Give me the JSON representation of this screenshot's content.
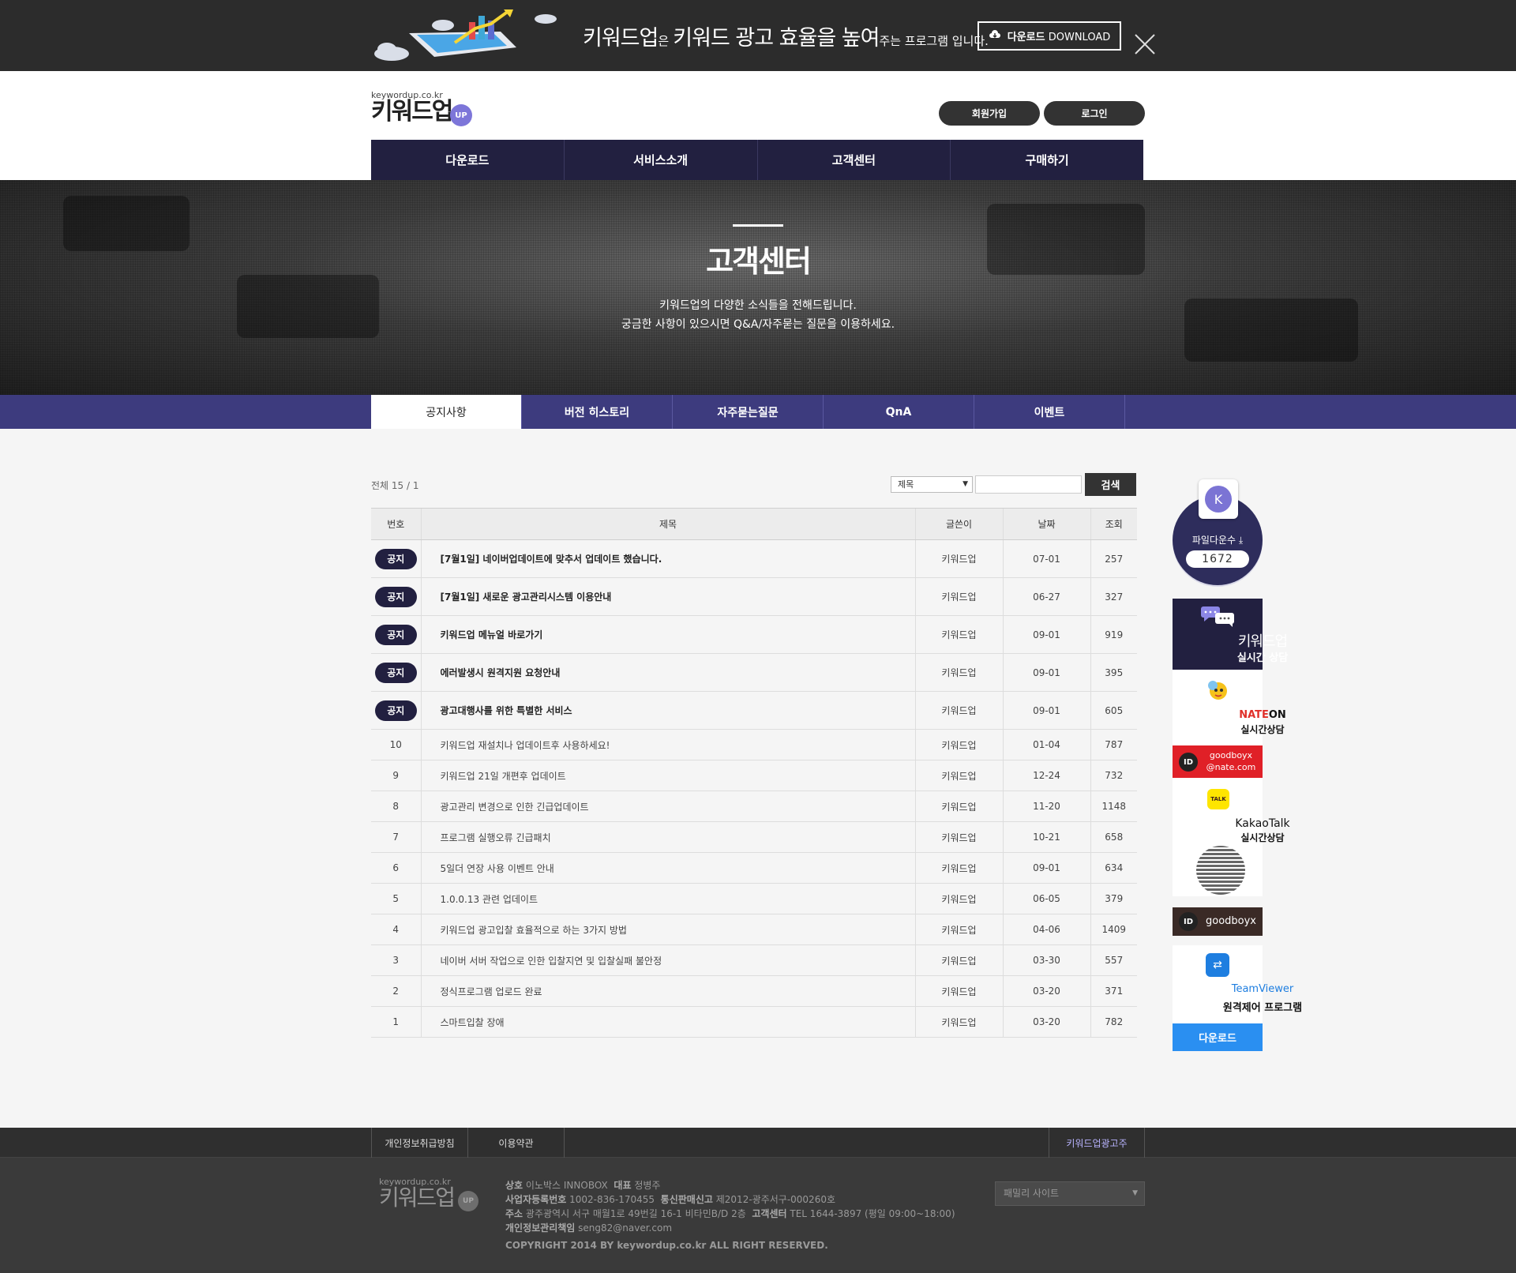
{
  "top_banner": {
    "promo_brand": "키워드업",
    "promo_particle": "은",
    "promo_main": "키워드 광고 효율을 높여",
    "promo_tail": "주는 프로그램 입니다.",
    "download_bold": "다운로드",
    "download_label": "DOWNLOAD",
    "icons": [
      "cloud-download-icon",
      "close-icon"
    ]
  },
  "header": {
    "logo_url": "keywordup.co.kr",
    "logo_name": "키워드업",
    "logo_badge": "UP",
    "join_label": "회원가입",
    "login_label": "로그인",
    "gnb": [
      "다운로드",
      "서비스소개",
      "고객센터",
      "구매하기"
    ]
  },
  "hero": {
    "title": "고객센터",
    "line1": "키워드업의 다양한 소식들을 전해드립니다.",
    "line2": "궁금한 사항이 있으시면 Q&A/자주묻는 질문을 이용하세요."
  },
  "subtabs": [
    "공지사항",
    "버전 히스토리",
    "자주묻는질문",
    "QnA",
    "이벤트"
  ],
  "board": {
    "total": "전체 15 / 1",
    "search_select": "제목",
    "search_button": "검색",
    "headers": [
      "번호",
      "제목",
      "글쓴이",
      "날짜",
      "조회"
    ],
    "notice_badge": "공지",
    "notices": [
      {
        "title": "[7월1일] 네이버업데이트에 맞추서 업데이트 했습니다.",
        "writer": "키워드업",
        "date": "07-01",
        "views": "257"
      },
      {
        "title": "[7월1일] 새로운 광고관리시스템 이용안내",
        "writer": "키워드업",
        "date": "06-27",
        "views": "327"
      },
      {
        "title": "키워드업 메뉴얼 바로가기",
        "writer": "키워드업",
        "date": "09-01",
        "views": "919"
      },
      {
        "title": "에러발생시 원격지원 요청안내",
        "writer": "키워드업",
        "date": "09-01",
        "views": "395"
      },
      {
        "title": "광고대행사를 위한 특별한 서비스",
        "writer": "키워드업",
        "date": "09-01",
        "views": "605"
      }
    ],
    "rows": [
      {
        "no": "10",
        "title": "키워드업 재설치나 업데이트후 사용하세요!",
        "writer": "키워드업",
        "date": "01-04",
        "views": "787"
      },
      {
        "no": "9",
        "title": "키워드업 21일 개편후 업데이트",
        "writer": "키워드업",
        "date": "12-24",
        "views": "732"
      },
      {
        "no": "8",
        "title": "광고관리 변경으로 인한 긴급업데이트",
        "writer": "키워드업",
        "date": "11-20",
        "views": "1148"
      },
      {
        "no": "7",
        "title": "프로그램 실행오류 긴급패치",
        "writer": "키워드업",
        "date": "10-21",
        "views": "658"
      },
      {
        "no": "6",
        "title": "5일더 연장 사용 이벤트 안내",
        "writer": "키워드업",
        "date": "09-01",
        "views": "634"
      },
      {
        "no": "5",
        "title": "1.0.0.13 관련 업데이트",
        "writer": "키워드업",
        "date": "06-05",
        "views": "379"
      },
      {
        "no": "4",
        "title": "키워드업 광고입찰 효율적으로 하는 3가지 방법",
        "writer": "키워드업",
        "date": "04-06",
        "views": "1409"
      },
      {
        "no": "3",
        "title": "네이버 서버 작업으로 인한 입찰지연 및 입찰실패 불안정",
        "writer": "키워드업",
        "date": "03-30",
        "views": "557"
      },
      {
        "no": "2",
        "title": "정식프로그램 업로드 완료",
        "writer": "키워드업",
        "date": "03-20",
        "views": "371"
      },
      {
        "no": "1",
        "title": "스마트입찰 장애",
        "writer": "키워드업",
        "date": "03-20",
        "views": "782"
      }
    ]
  },
  "quick": {
    "k_letter": "K",
    "download_count_label": "파일다운수",
    "download_count": "1672",
    "live_title": "키워드업",
    "live_sub": "실시간 상담",
    "nate_logo_a": "NATE",
    "nate_logo_b": "ON",
    "nate_sub": "실시간상담",
    "id_badge": "ID",
    "nate_id_line1": "goodboyx",
    "nate_id_line2": "@nate.com",
    "kakao_bubble": "TALK",
    "kakao_logo": "KakaoTalk",
    "kakao_sub": "실시간상담",
    "kakao_id": "goodboyx",
    "tv_logo": "TeamViewer",
    "tv_sub": "원격제어 프로그램",
    "tv_button": "다운로드"
  },
  "footer": {
    "links": [
      "개인정보취급방침",
      "이용약관",
      "키워드업광고주"
    ],
    "logo_url": "keywordup.co.kr",
    "logo_name": "키워드업",
    "logo_badge": "UP",
    "company_label": "상호",
    "company": "이노박스 INNOBOX",
    "ceo_label": "대표",
    "ceo": "정병주",
    "biz_label": "사업자등록번호",
    "biz": "1002-836-170455",
    "mail_order_label": "통신판매신고",
    "mail_order": "제2012-광주서구-000260호",
    "addr_label": "주소",
    "addr": "광주광역시 서구 매월1로 49번길 16-1 비타민B/D 2층",
    "cs_label": "고객센터",
    "cs": "TEL 1644-3897 (평일 09:00~18:00)",
    "privacy_label": "개인정보관리책임",
    "privacy": "seng82@naver.com",
    "copyright": "COPYRIGHT 2014 BY keywordup.co.kr ALL RIGHT RESERVED.",
    "family_site": "패밀리 사이트"
  }
}
